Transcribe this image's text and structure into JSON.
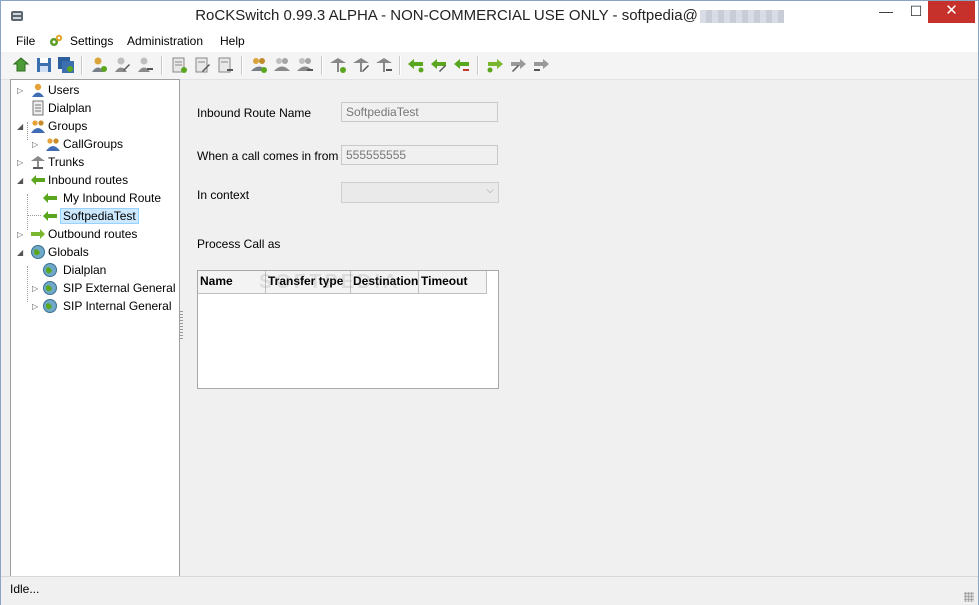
{
  "window": {
    "title": "RoCKSwitch 0.99.3 ALPHA - NON-COMMERCIAL USE ONLY - softpedia@",
    "minimize": "—",
    "maximize": "☐",
    "close": "✕"
  },
  "menu": {
    "file": "File",
    "settings": "Settings",
    "administration": "Administration",
    "help": "Help"
  },
  "toolbar": {
    "icons": [
      "refresh-icon",
      "save-icon",
      "save-all-icon",
      "add-user-icon",
      "edit-user-icon",
      "delete-user-icon",
      "add-dialplan-icon",
      "edit-dialplan-icon",
      "delete-dialplan-icon",
      "add-group-icon",
      "edit-group-icon",
      "delete-group-icon",
      "add-trunk-icon",
      "edit-trunk-icon",
      "delete-trunk-icon",
      "add-inbound-route-icon",
      "edit-inbound-route-icon",
      "delete-inbound-route-icon",
      "add-outbound-route-icon",
      "edit-outbound-route-icon",
      "delete-outbound-route-icon"
    ]
  },
  "tree": {
    "users": "Users",
    "dialplan": "Dialplan",
    "groups": "Groups",
    "callgroups": "CallGroups",
    "trunks": "Trunks",
    "inbound_routes": "Inbound routes",
    "my_inbound_route": "My Inbound Route",
    "softpedia_test": "SoftpediaTest",
    "outbound_routes": "Outbound routes",
    "globals": "Globals",
    "globals_dialplan": "Dialplan",
    "sip_external": "SIP External General",
    "sip_internal": "SIP Internal General"
  },
  "form": {
    "route_name_label": "Inbound Route Name",
    "route_name_value": "SoftpediaTest",
    "call_from_label": "When a call comes in from",
    "call_from_value": "555555555",
    "context_label": "In context",
    "context_value": "",
    "process_label": "Process Call as"
  },
  "grid": {
    "columns": [
      "Name",
      "Transfer type",
      "Destination",
      "Timeout"
    ],
    "rows": []
  },
  "watermark": "SOFTPEDIA",
  "status": {
    "text": "Idle..."
  },
  "colors": {
    "accent_close": "#c7312b",
    "selection": "#cce8ff",
    "inbound_arrow": "#5aa61e",
    "outbound_arrow": "#7ab72e"
  }
}
